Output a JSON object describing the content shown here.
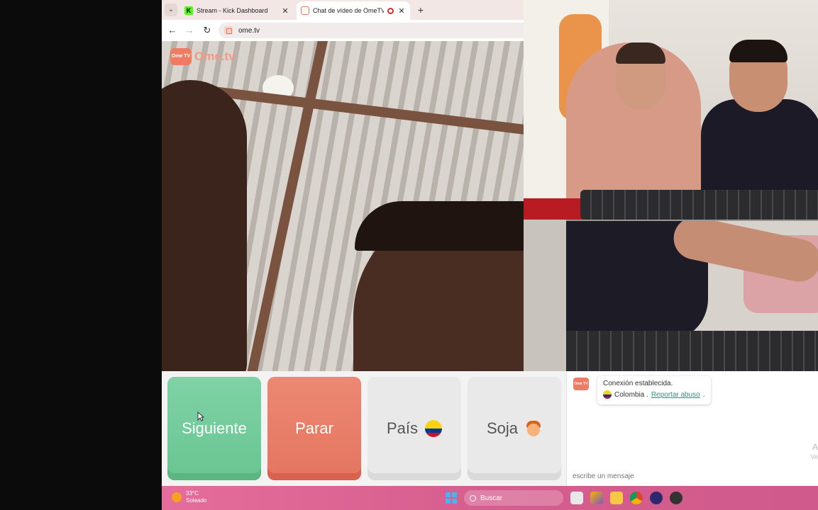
{
  "browser": {
    "tabs": [
      {
        "title": "Stream - Kick Dashboard",
        "favicon": "kick-icon"
      },
      {
        "title": "Chat de vídeo de OmeTV: al",
        "favicon": "ometv-icon",
        "active": true
      }
    ],
    "kick_glyph": "K",
    "url": "ome.tv"
  },
  "brand": {
    "icon_text": "Ome TV",
    "name": "Ome.tv",
    "color": "#f09a86"
  },
  "controls": {
    "next_label": "Siguiente",
    "stop_label": "Parar",
    "country_label": "País",
    "gender_label": "Soja",
    "next_color": "#6fcb98",
    "stop_color": "#e87b66"
  },
  "chat": {
    "avatar_text": "Ome TV",
    "status": "Conexión establecida.",
    "country": "Colombia .",
    "report_link": "Reportar abuso",
    "report_suffix": ".",
    "side_text_1": "A",
    "side_text_2": "Ve",
    "input_placeholder": "escribe un mensaje"
  },
  "taskbar": {
    "temperature": "33°C",
    "condition": "Soleado",
    "search_label": "Buscar"
  }
}
